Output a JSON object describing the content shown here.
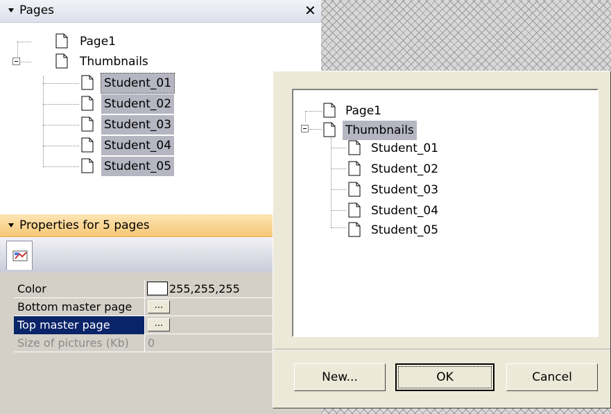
{
  "pages_panel": {
    "title": "Pages",
    "close_label": "✕",
    "tree": {
      "root_items": [
        "Page1",
        "Thumbnails"
      ],
      "children": [
        "Student_01",
        "Student_02",
        "Student_03",
        "Student_04",
        "Student_05"
      ]
    }
  },
  "properties_panel": {
    "title": "Properties for 5 pages",
    "rows": [
      {
        "name": "Color",
        "value": "255,255,255"
      },
      {
        "name": "Bottom master page",
        "value": "..."
      },
      {
        "name": "Top master page",
        "value": "..."
      },
      {
        "name": "Size of pictures (Kb)",
        "value": "0"
      }
    ]
  },
  "dialog": {
    "tree": {
      "root_items": [
        "Page1",
        "Thumbnails"
      ],
      "children": [
        "Student_01",
        "Student_02",
        "Student_03",
        "Student_04",
        "Student_05"
      ]
    },
    "buttons": {
      "new": "New...",
      "ok": "OK",
      "cancel": "Cancel"
    }
  }
}
